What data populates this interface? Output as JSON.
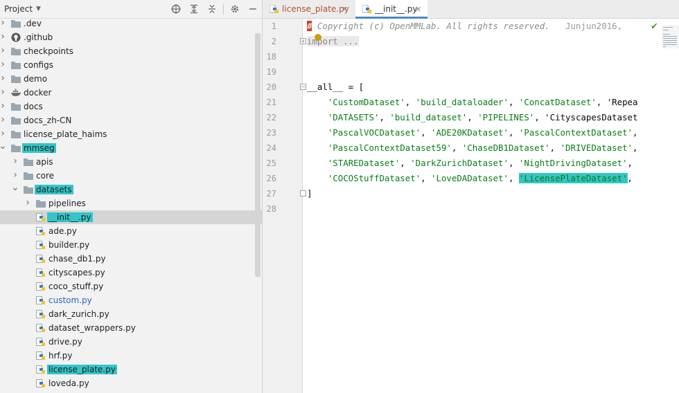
{
  "project_panel": {
    "title": "Project",
    "toolbar": [
      "target-icon",
      "expand-all-icon",
      "collapse-all-icon",
      "gear-icon",
      "minimize-icon"
    ],
    "tree": [
      {
        "label": ".dev",
        "type": "folder",
        "depth": 0,
        "expanded": false
      },
      {
        "label": ".github",
        "type": "github",
        "depth": 0,
        "expanded": false
      },
      {
        "label": "checkpoints",
        "type": "folder",
        "depth": 0,
        "expanded": false
      },
      {
        "label": "configs",
        "type": "folder",
        "depth": 0,
        "expanded": false
      },
      {
        "label": "demo",
        "type": "folder",
        "depth": 0,
        "expanded": false
      },
      {
        "label": "docker",
        "type": "docker",
        "depth": 0,
        "expanded": false
      },
      {
        "label": "docs",
        "type": "folder",
        "depth": 0,
        "expanded": false
      },
      {
        "label": "docs_zh-CN",
        "type": "folder",
        "depth": 0,
        "expanded": false
      },
      {
        "label": "license_plate_haims",
        "type": "folder",
        "depth": 0,
        "expanded": false
      },
      {
        "label": "mmseg",
        "type": "folder",
        "depth": 0,
        "expanded": true,
        "highlight": true
      },
      {
        "label": "apis",
        "type": "folder",
        "depth": 1,
        "expanded": false
      },
      {
        "label": "core",
        "type": "folder",
        "depth": 1,
        "expanded": false
      },
      {
        "label": "datasets",
        "type": "folder",
        "depth": 1,
        "expanded": true,
        "highlight": true
      },
      {
        "label": "pipelines",
        "type": "folder",
        "depth": 2,
        "expanded": false
      },
      {
        "label": "__init__.py",
        "type": "py",
        "depth": 2,
        "selected": true,
        "highlight": true
      },
      {
        "label": "ade.py",
        "type": "py",
        "depth": 2
      },
      {
        "label": "builder.py",
        "type": "py",
        "depth": 2
      },
      {
        "label": "chase_db1.py",
        "type": "py",
        "depth": 2
      },
      {
        "label": "cityscapes.py",
        "type": "py",
        "depth": 2
      },
      {
        "label": "coco_stuff.py",
        "type": "py",
        "depth": 2
      },
      {
        "label": "custom.py",
        "type": "py",
        "depth": 2,
        "modified": true
      },
      {
        "label": "dark_zurich.py",
        "type": "py",
        "depth": 2
      },
      {
        "label": "dataset_wrappers.py",
        "type": "py",
        "depth": 2
      },
      {
        "label": "drive.py",
        "type": "py",
        "depth": 2
      },
      {
        "label": "hrf.py",
        "type": "py",
        "depth": 2
      },
      {
        "label": "license_plate.py",
        "type": "py",
        "depth": 2,
        "highlight": true
      },
      {
        "label": "loveda.py",
        "type": "py",
        "depth": 2
      }
    ]
  },
  "editor": {
    "tabs": [
      {
        "label": "license_plate.py",
        "active": false,
        "modified": true
      },
      {
        "label": "__init__.py",
        "active": true,
        "modified": false
      }
    ],
    "lines": [
      {
        "num": "1",
        "code": "# Copyright (c) OpenMMLab. All rights reserved.",
        "annotation": "Junjun2016,"
      },
      {
        "num": "2",
        "code": "import ..."
      },
      {
        "num": "18",
        "code": ""
      },
      {
        "num": "19",
        "code": ""
      },
      {
        "num": "20",
        "code": "__all__ = ["
      },
      {
        "num": "21",
        "code": "    'CustomDataset', 'build_dataloader', 'ConcatDataset', 'Repea"
      },
      {
        "num": "22",
        "code": "    'DATASETS', 'build_dataset', 'PIPELINES', 'CityscapesDataset"
      },
      {
        "num": "23",
        "code": "    'PascalVOCDataset', 'ADE20KDataset', 'PascalContextDataset',"
      },
      {
        "num": "24",
        "code": "    'PascalContextDataset59', 'ChaseDB1Dataset', 'DRIVEDataset',"
      },
      {
        "num": "25",
        "code": "    'STAREDataset', 'DarkZurichDataset', 'NightDrivingDataset',"
      },
      {
        "num": "26",
        "code": "    'COCOStuffDataset', 'LoveDADataset', 'LicensePlateDataset',"
      },
      {
        "num": "27",
        "code": "]"
      },
      {
        "num": "28",
        "code": ""
      }
    ]
  },
  "colors": {
    "highlight": "#34c5c7",
    "string": "#067d17",
    "comment": "#8c8c8c",
    "selection_row": "#d5d5d5",
    "modified_file": "#2666b8",
    "active_tab_underline": "#4a88c7"
  }
}
